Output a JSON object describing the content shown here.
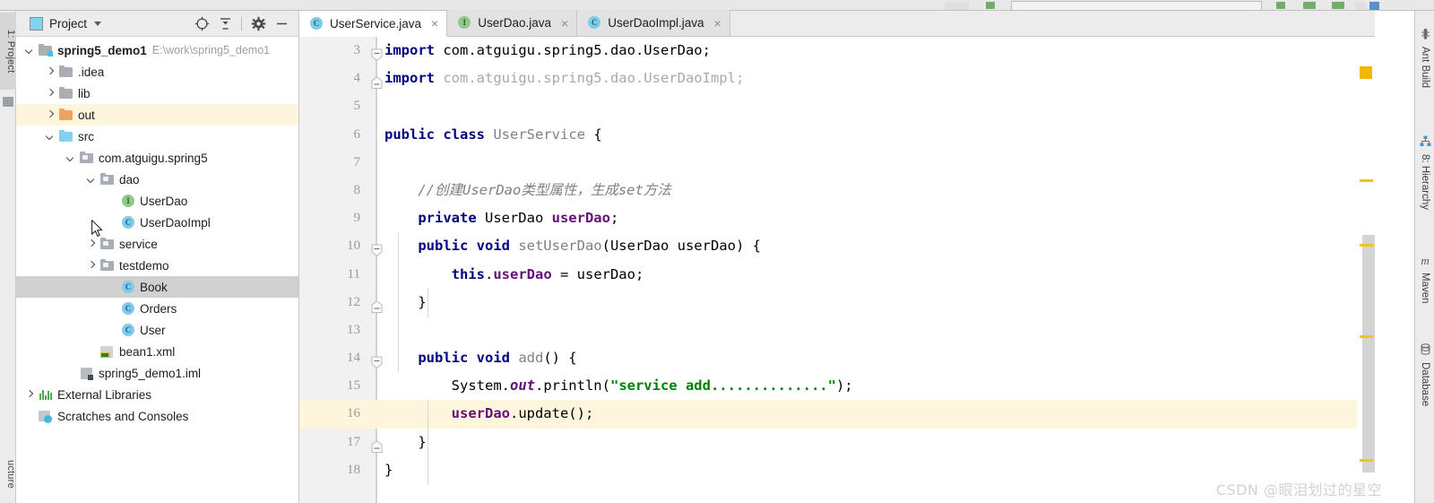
{
  "window": {
    "toolbar_strip_note": ""
  },
  "left_rail": {
    "project_button": "1: Project",
    "structure_button": "ucture"
  },
  "project_panel": {
    "title": "Project",
    "tools": [
      {
        "name": "locate-icon",
        "glyph": "locate"
      },
      {
        "name": "collapse-all-icon",
        "glyph": "collapse"
      },
      {
        "name": "settings-gear-icon",
        "glyph": "gear"
      },
      {
        "name": "hide-icon",
        "glyph": "minus"
      }
    ],
    "tree": [
      {
        "label": "spring5_demo1",
        "suffix": "E:\\work\\spring5_demo1",
        "icon": "module-folder-icon",
        "arrow": "down",
        "indent": 0,
        "bold": true,
        "state": "normal"
      },
      {
        "label": ".idea",
        "suffix": "",
        "icon": "folder-icon",
        "arrow": "right",
        "indent": 1,
        "bold": false,
        "state": "normal"
      },
      {
        "label": "lib",
        "suffix": "",
        "icon": "folder-icon",
        "arrow": "right",
        "indent": 1,
        "bold": false,
        "state": "normal"
      },
      {
        "label": "out",
        "suffix": "",
        "icon": "folder-orange-icon",
        "arrow": "right",
        "indent": 1,
        "bold": false,
        "state": "highlight"
      },
      {
        "label": "src",
        "suffix": "",
        "icon": "folder-blue-icon",
        "arrow": "down",
        "indent": 1,
        "bold": false,
        "state": "normal"
      },
      {
        "label": "com.atguigu.spring5",
        "suffix": "",
        "icon": "package-icon",
        "arrow": "down",
        "indent": 2,
        "bold": false,
        "state": "normal"
      },
      {
        "label": "dao",
        "suffix": "",
        "icon": "package-icon",
        "arrow": "down",
        "indent": 3,
        "bold": false,
        "state": "normal"
      },
      {
        "label": "UserDao",
        "suffix": "",
        "icon": "interface-icon",
        "arrow": "none",
        "indent": 4,
        "bold": false,
        "state": "normal"
      },
      {
        "label": "UserDaoImpl",
        "suffix": "",
        "icon": "class-icon",
        "arrow": "none",
        "indent": 4,
        "bold": false,
        "state": "normal"
      },
      {
        "label": "service",
        "suffix": "",
        "icon": "package-icon",
        "arrow": "right",
        "indent": 3,
        "bold": false,
        "state": "normal"
      },
      {
        "label": "testdemo",
        "suffix": "",
        "icon": "package-icon",
        "arrow": "right",
        "indent": 3,
        "bold": false,
        "state": "normal"
      },
      {
        "label": "Book",
        "suffix": "",
        "icon": "class-icon",
        "arrow": "none",
        "indent": 4,
        "bold": false,
        "state": "selected"
      },
      {
        "label": "Orders",
        "suffix": "",
        "icon": "class-icon",
        "arrow": "none",
        "indent": 4,
        "bold": false,
        "state": "normal"
      },
      {
        "label": "User",
        "suffix": "",
        "icon": "class-icon",
        "arrow": "none",
        "indent": 4,
        "bold": false,
        "state": "normal"
      },
      {
        "label": "bean1.xml",
        "suffix": "",
        "icon": "xml-file-icon",
        "arrow": "none",
        "indent": 3,
        "bold": false,
        "state": "normal"
      },
      {
        "label": "spring5_demo1.iml",
        "suffix": "",
        "icon": "iml-file-icon",
        "arrow": "none",
        "indent": 2,
        "bold": false,
        "state": "normal"
      },
      {
        "label": "External Libraries",
        "suffix": "",
        "icon": "libraries-icon",
        "arrow": "right",
        "indent": 0,
        "bold": false,
        "state": "normal"
      },
      {
        "label": "Scratches and Consoles",
        "suffix": "",
        "icon": "scratches-icon",
        "arrow": "none",
        "indent": 0,
        "bold": false,
        "state": "normal"
      }
    ]
  },
  "editor": {
    "tabs": [
      {
        "label": "UserService.java",
        "icon": "class-icon",
        "active": true,
        "close": "×"
      },
      {
        "label": "UserDao.java",
        "icon": "interface-icon",
        "active": false,
        "close": "×"
      },
      {
        "label": "UserDaoImpl.java",
        "icon": "class-icon",
        "active": false,
        "close": "×"
      }
    ],
    "caret_line": 16,
    "lines": [
      {
        "num": "3",
        "fold": "minus-down",
        "caret": false,
        "tokens": [
          {
            "t": "import ",
            "c": "kw"
          },
          {
            "t": "com.atguigu.spring5.dao.UserDao;",
            "c": "plain"
          }
        ]
      },
      {
        "num": "4",
        "fold": "minus-box",
        "caret": false,
        "tokens": [
          {
            "t": "import ",
            "c": "kw"
          },
          {
            "t": "com.atguigu.spring5.dao.UserDaoImpl;",
            "c": "dim"
          }
        ]
      },
      {
        "num": "5",
        "fold": "none",
        "caret": false,
        "tokens": []
      },
      {
        "num": "6",
        "fold": "none",
        "caret": false,
        "tokens": [
          {
            "t": "public class ",
            "c": "kw"
          },
          {
            "t": "UserService",
            "c": "id"
          },
          {
            "t": " {",
            "c": "plain"
          }
        ]
      },
      {
        "num": "7",
        "fold": "none",
        "caret": false,
        "tokens": []
      },
      {
        "num": "8",
        "fold": "none",
        "caret": false,
        "tokens": [
          {
            "t": "    //创建UserDao类型属性，生成set方法",
            "c": "cmt"
          }
        ]
      },
      {
        "num": "9",
        "fold": "none",
        "caret": false,
        "tokens": [
          {
            "t": "    ",
            "c": "plain"
          },
          {
            "t": "private ",
            "c": "kw"
          },
          {
            "t": "UserDao ",
            "c": "plain"
          },
          {
            "t": "userDao",
            "c": "fld"
          },
          {
            "t": ";",
            "c": "plain"
          }
        ]
      },
      {
        "num": "10",
        "fold": "minus-down",
        "caret": false,
        "tokens": [
          {
            "t": "    ",
            "c": "plain"
          },
          {
            "t": "public void ",
            "c": "kw"
          },
          {
            "t": "setUserDao",
            "c": "id"
          },
          {
            "t": "(UserDao userDao) {",
            "c": "plain"
          }
        ]
      },
      {
        "num": "11",
        "fold": "none",
        "caret": false,
        "tokens": [
          {
            "t": "        ",
            "c": "plain"
          },
          {
            "t": "this",
            "c": "kw"
          },
          {
            "t": ".",
            "c": "plain"
          },
          {
            "t": "userDao",
            "c": "fld"
          },
          {
            "t": " = userDao;",
            "c": "plain"
          }
        ]
      },
      {
        "num": "12",
        "fold": "minus-box",
        "caret": false,
        "tokens": [
          {
            "t": "    }",
            "c": "plain"
          }
        ]
      },
      {
        "num": "13",
        "fold": "none",
        "caret": false,
        "tokens": []
      },
      {
        "num": "14",
        "fold": "minus-down",
        "caret": false,
        "tokens": [
          {
            "t": "    ",
            "c": "plain"
          },
          {
            "t": "public void ",
            "c": "kw"
          },
          {
            "t": "add",
            "c": "id"
          },
          {
            "t": "() {",
            "c": "plain"
          }
        ]
      },
      {
        "num": "15",
        "fold": "none",
        "caret": false,
        "tokens": [
          {
            "t": "        System.",
            "c": "plain"
          },
          {
            "t": "out",
            "c": "stat"
          },
          {
            "t": ".println(",
            "c": "plain"
          },
          {
            "t": "\"service add..............\"",
            "c": "str"
          },
          {
            "t": ");",
            "c": "plain"
          }
        ]
      },
      {
        "num": "16",
        "fold": "none",
        "caret": true,
        "tokens": [
          {
            "t": "        ",
            "c": "plain"
          },
          {
            "t": "userDao",
            "c": "fld"
          },
          {
            "t": ".update();",
            "c": "plain"
          }
        ]
      },
      {
        "num": "17",
        "fold": "minus-box",
        "caret": false,
        "tokens": [
          {
            "t": "    }",
            "c": "plain"
          }
        ]
      },
      {
        "num": "18",
        "fold": "none",
        "caret": false,
        "tokens": [
          {
            "t": "}",
            "c": "plain"
          }
        ]
      }
    ],
    "marker_warning": "warning-marker",
    "scroll_marks": 4
  },
  "right_rail": {
    "buttons": [
      {
        "label": "Ant Build",
        "icon": "ant-icon"
      },
      {
        "label": "8: Hierarchy",
        "icon": "hierarchy-icon"
      },
      {
        "label": "Maven",
        "icon": "maven-icon"
      },
      {
        "label": "Database",
        "icon": "database-icon"
      }
    ]
  },
  "watermark": {
    "text": "CSDN @眼泪划过的星空"
  },
  "colors": {
    "keyword": "#000080",
    "string": "#008000",
    "field": "#660e7a",
    "comment": "#808080",
    "caret_line": "#fdf6dd",
    "selection": "#d0d0d0",
    "warning": "#f2b705"
  }
}
